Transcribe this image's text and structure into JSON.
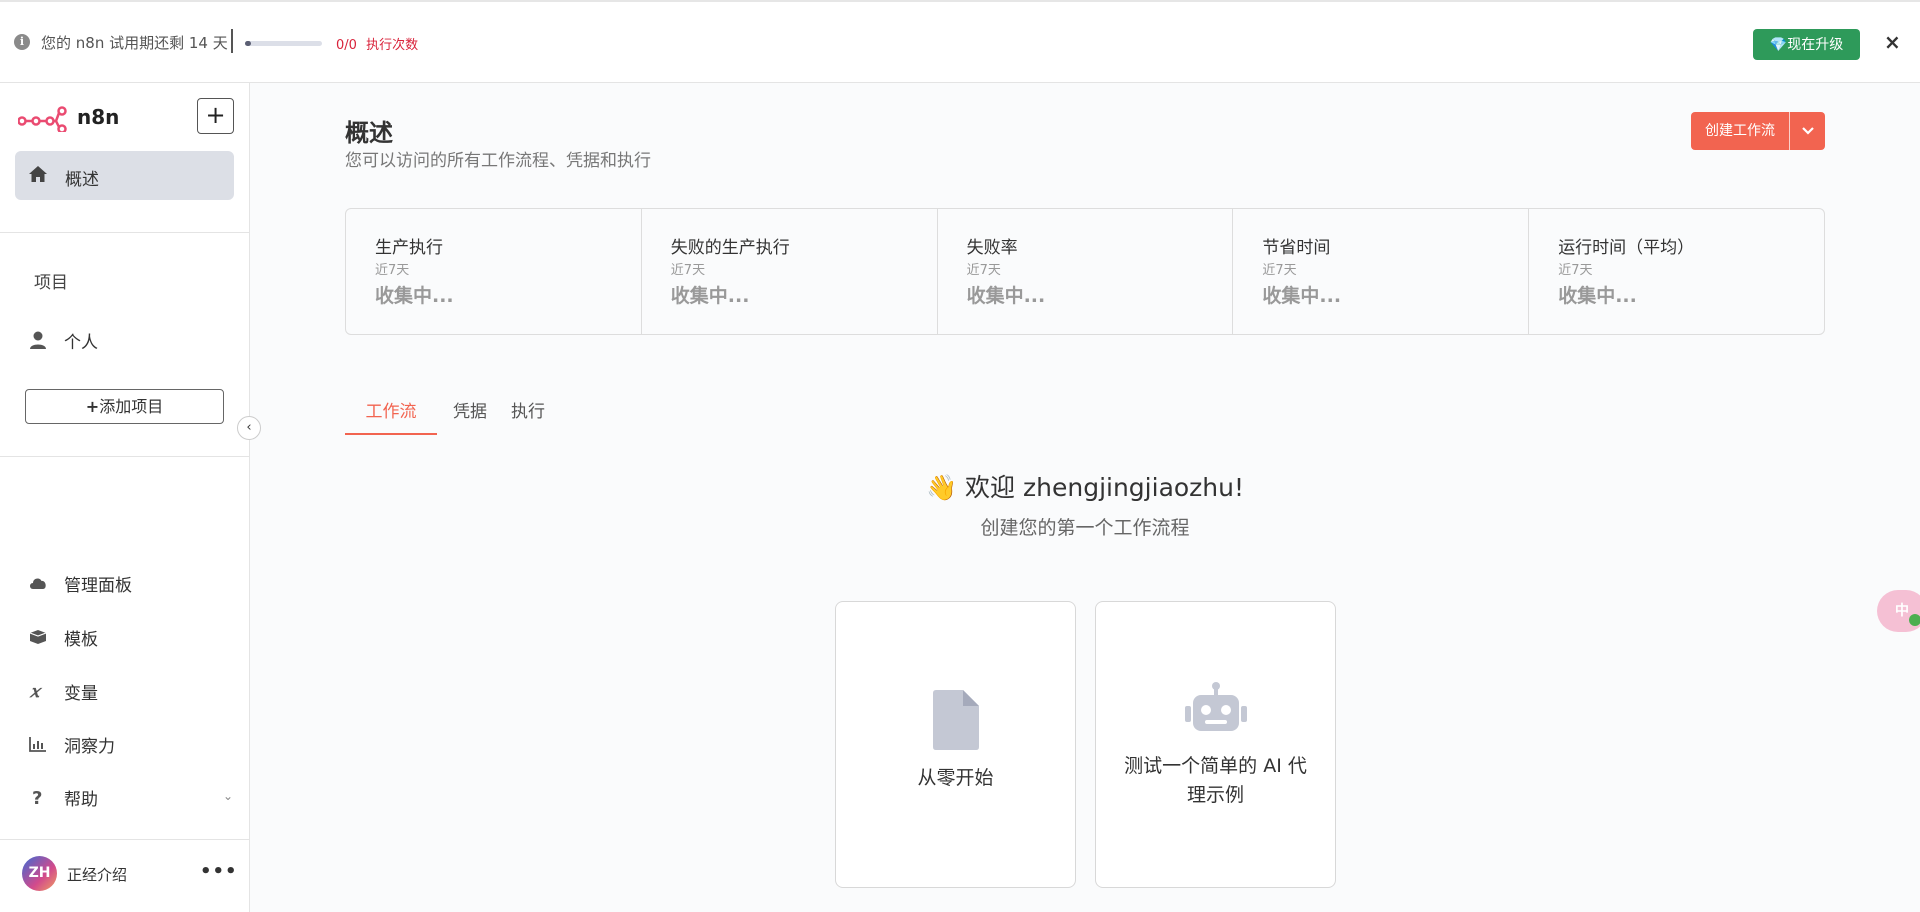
{
  "banner": {
    "trial_text": "您的 n8n 试用期还剩 14 天",
    "exec_count": "0/0",
    "exec_label": "执行次数",
    "progress_fraction": 0.0,
    "upgrade_label": "现在升级",
    "close_label": "×"
  },
  "sidebar": {
    "logo_text": "n8n",
    "add_button": "+",
    "overview_label": "概述",
    "projects_label": "项目",
    "personal_label": "个人",
    "add_project_label": "添加项目",
    "items": [
      {
        "label": "管理面板",
        "icon": "cloud-icon"
      },
      {
        "label": "模板",
        "icon": "box-icon"
      },
      {
        "label": "变量",
        "icon": "variable-icon"
      },
      {
        "label": "洞察力",
        "icon": "chart-icon"
      },
      {
        "label": "帮助",
        "icon": "question-icon"
      }
    ],
    "user": {
      "initials": "ZH",
      "name": "正经介绍",
      "menu": "•••"
    }
  },
  "main": {
    "title": "概述",
    "subtitle": "您可以访问的所有工作流程、凭据和执行",
    "create_button": "创建工作流",
    "stats": [
      {
        "title": "生产执行",
        "period": "近7天",
        "value": "收集中..."
      },
      {
        "title": "失败的生产执行",
        "period": "近7天",
        "value": "收集中..."
      },
      {
        "title": "失败率",
        "period": "近7天",
        "value": "收集中..."
      },
      {
        "title": "节省时间",
        "period": "近7天",
        "value": "收集中..."
      },
      {
        "title": "运行时间（平均）",
        "period": "近7天",
        "value": "收集中..."
      }
    ],
    "tabs": [
      {
        "label": "工作流",
        "active": true
      },
      {
        "label": "凭据",
        "active": false
      },
      {
        "label": "执行",
        "active": false
      }
    ],
    "welcome": "👋 欢迎 zhengjingjiaozhu!",
    "welcome_sub": "创建您的第一个工作流程",
    "cards": [
      {
        "label": "从零开始",
        "icon": "file-icon"
      },
      {
        "label": "测试一个简单的 AI 代理示例",
        "icon": "robot-icon"
      }
    ]
  },
  "colors": {
    "accent": "#f26450",
    "upgrade": "#2e9a5a",
    "exec_count": "#d9233b"
  }
}
